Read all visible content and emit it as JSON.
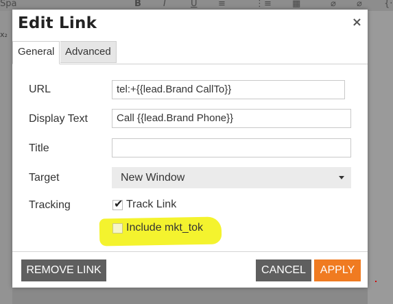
{
  "dialog": {
    "title": "Edit Link",
    "close_glyph": "×"
  },
  "tabs": [
    {
      "label": "General",
      "active": true
    },
    {
      "label": "Advanced",
      "active": false
    }
  ],
  "form": {
    "url": {
      "label": "URL",
      "value": "tel:+{{lead.Brand CallTo}}"
    },
    "display_text": {
      "label": "Display Text",
      "value": "Call {{lead.Brand Phone}}"
    },
    "title": {
      "label": "Title",
      "value": ""
    },
    "target": {
      "label": "Target",
      "selected": "New Window"
    },
    "tracking": {
      "label": "Tracking",
      "track_link": {
        "label": "Track Link",
        "checked": true
      },
      "include_mkt_tok": {
        "label": "Include mkt_tok",
        "checked": false
      }
    }
  },
  "buttons": {
    "remove_link": "REMOVE LINK",
    "cancel": "CANCEL",
    "apply": "APPLY"
  },
  "colors": {
    "apply": "#f07b21",
    "secondary_button": "#5f5f5f",
    "highlight": "#f4f32e",
    "backdrop": "#898989"
  }
}
